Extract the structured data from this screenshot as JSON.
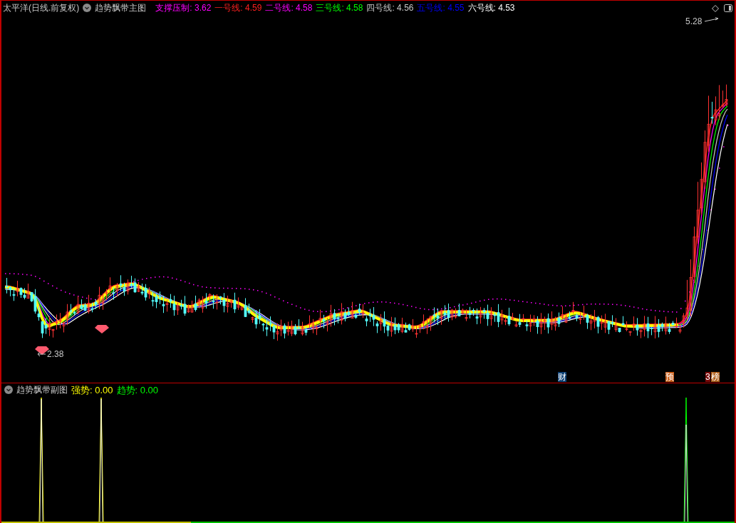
{
  "main_panel": {
    "stock_title": "太平洋(日线.前复权)",
    "indicator_title": "趋势飘带主图",
    "legend": [
      {
        "text": "支撑压制: 3.62",
        "color": "#ff00ff"
      },
      {
        "text": "一号线: 4.59",
        "color": "#ff2020"
      },
      {
        "text": "二号线: 4.58",
        "color": "#ff00ff"
      },
      {
        "text": "三号线: 4.58",
        "color": "#00ff00"
      },
      {
        "text": "四号线: 4.56",
        "color": "#c8c8c8"
      },
      {
        "text": "五号线: 4.55",
        "color": "#0000ff"
      },
      {
        "text": "六号线: 4.53",
        "color": "#ffffff"
      }
    ],
    "high_label": "5.28",
    "low_label": "2.38",
    "markers": [
      {
        "text": "财",
        "color": "#0b3f73"
      },
      {
        "text": "预",
        "color": "#c85a14"
      },
      {
        "text": "3",
        "color": "#7a0a0a"
      },
      {
        "text": "榜",
        "color": "#b0601c"
      }
    ]
  },
  "sub_panel": {
    "indicator_title": "趋势飘带副图",
    "legend": [
      {
        "text": "强势: 0.00",
        "color": "#ffff00"
      },
      {
        "text": "趋势: 0.00",
        "color": "#00ff00"
      }
    ]
  }
}
